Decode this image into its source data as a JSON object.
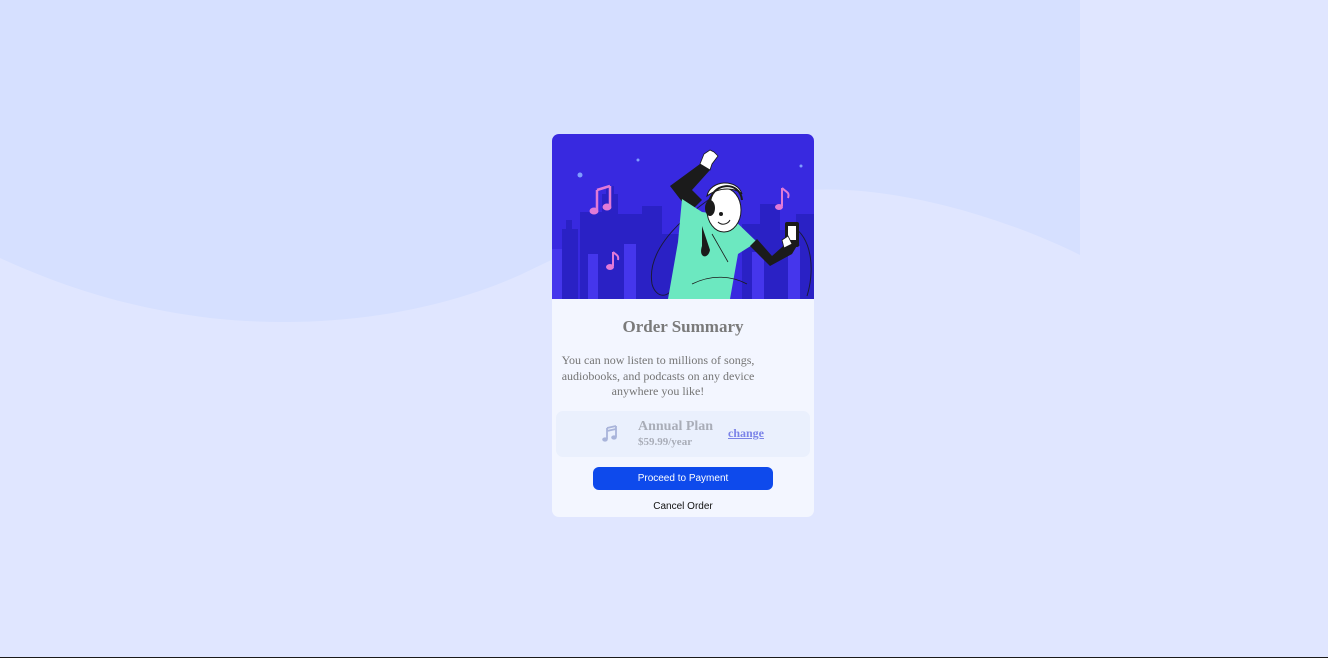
{
  "colors": {
    "background": "#e0e6ff",
    "wave": "#d6e0ff",
    "card": "#f3f6ff",
    "hero_bg": "#3829e0",
    "primary_button": "#0e4aec",
    "link": "#7b83e8"
  },
  "card": {
    "hero_image": "person-dancing-with-headphones-illustration",
    "title": "Order Summary",
    "description": "You can now listen to millions of songs, audiobooks, and podcasts on any device anywhere you like!",
    "plan": {
      "icon": "music-note-icon",
      "name": "Annual Plan",
      "price": "$59.99/year",
      "change_label": "change"
    },
    "proceed_label": "Proceed to Payment",
    "cancel_label": "Cancel Order"
  }
}
